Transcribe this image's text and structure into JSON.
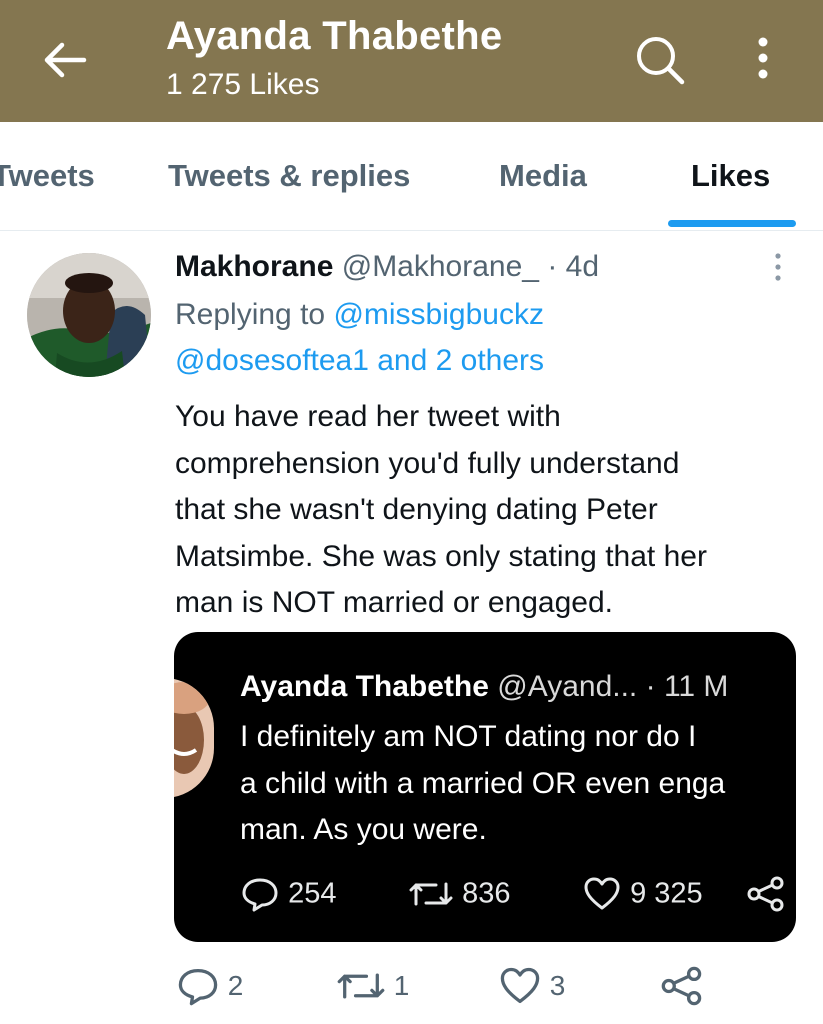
{
  "header": {
    "title": "Ayanda Thabethe",
    "subtitle": "1 275 Likes",
    "bg_color": "#847650"
  },
  "tabs": [
    {
      "label": "Tweets",
      "active": false
    },
    {
      "label": "Tweets & replies",
      "active": false
    },
    {
      "label": "Media",
      "active": false
    },
    {
      "label": "Likes",
      "active": true
    }
  ],
  "tweet": {
    "author_name": "Makhorane",
    "author_handle": "@Makhorane_",
    "separator": "·",
    "time": "4d",
    "replying_prefix": "Replying to",
    "replying_to_1": "@missbigbuckz",
    "replying_to_2": "@dosesoftea1 and 2 others",
    "body_lines": [
      "You have read her tweet with",
      "comprehension you'd fully understand",
      "that she wasn't denying dating Peter",
      "Matsimbe. She was only stating that her",
      "man is NOT married or engaged."
    ],
    "quote": {
      "author_name": "Ayanda Thabethe",
      "author_handle": "@Ayand...",
      "separator": "·",
      "time": "11 M",
      "body_lines": [
        "I definitely am NOT dating nor do I",
        "a child with a married OR even enga",
        "man. As you were."
      ],
      "replies": "254",
      "retweets": "836",
      "likes": "9 325"
    },
    "replies": "2",
    "retweets": "1",
    "likes": "3"
  },
  "colors": {
    "accent": "#1d9bf0",
    "muted": "#536471"
  }
}
